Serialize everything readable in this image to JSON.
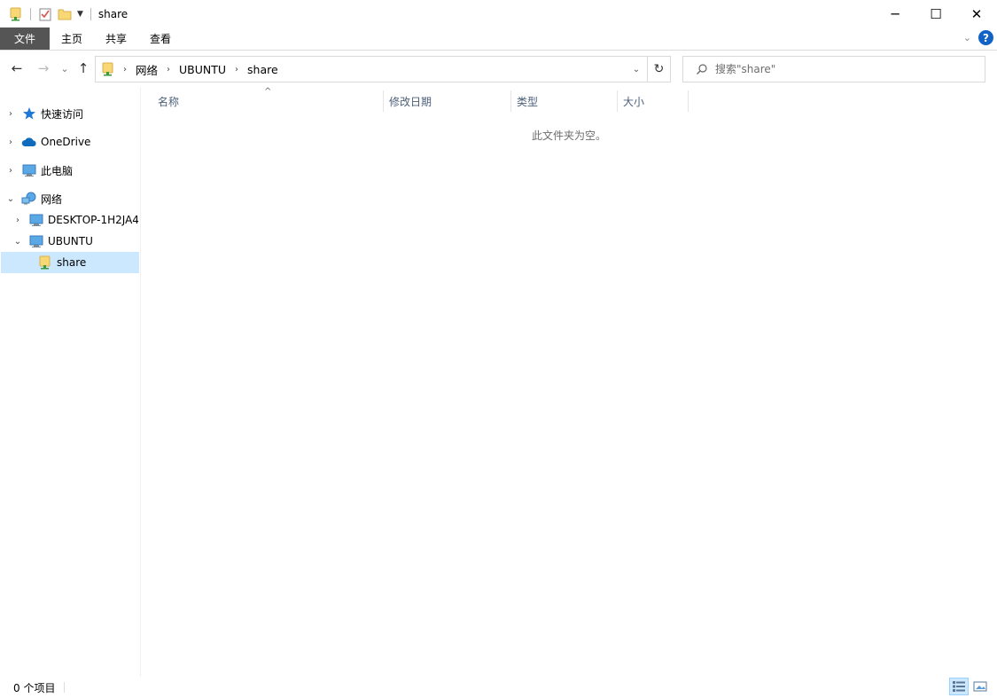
{
  "window": {
    "title": "share",
    "minimize": "─",
    "maximize": "☐",
    "close": "✕"
  },
  "quick_access_toolbar": {
    "icons": [
      "share-folder-icon",
      "properties-icon",
      "new-folder-icon",
      "customize-dropdown-icon"
    ]
  },
  "ribbon": {
    "tabs": [
      {
        "label": "文件"
      },
      {
        "label": "主页"
      },
      {
        "label": "共享"
      },
      {
        "label": "查看"
      }
    ],
    "help_label": "?"
  },
  "navigation": {
    "back": "←",
    "forward": "→",
    "recent": "⌄",
    "up": "↑"
  },
  "address_bar": {
    "crumbs": [
      {
        "label": "网络"
      },
      {
        "label": "UBUNTU"
      },
      {
        "label": "share"
      }
    ],
    "refresh": "↻"
  },
  "search": {
    "placeholder": "搜索\"share\""
  },
  "sidebar": {
    "items": [
      {
        "label": "快速访问",
        "icon": "star-icon",
        "expanded": false
      },
      {
        "label": "OneDrive",
        "icon": "cloud-icon",
        "expanded": false
      },
      {
        "label": "此电脑",
        "icon": "computer-icon",
        "expanded": false
      },
      {
        "label": "网络",
        "icon": "network-icon",
        "expanded": true
      },
      {
        "label": "DESKTOP-1H2JA4",
        "icon": "computer-icon",
        "expanded": false
      },
      {
        "label": "UBUNTU",
        "icon": "computer-icon",
        "expanded": true
      },
      {
        "label": "share",
        "icon": "share-folder-icon",
        "selected": true
      }
    ]
  },
  "columns": {
    "headers": [
      {
        "label": "名称"
      },
      {
        "label": "修改日期"
      },
      {
        "label": "类型"
      },
      {
        "label": "大小"
      }
    ],
    "sort_indicator": "^"
  },
  "content": {
    "empty_message": "此文件夹为空。"
  },
  "status_bar": {
    "item_count": "0 个项目"
  },
  "colors": {
    "accent": "#1163c5",
    "selection": "#cce8ff",
    "file_tab": "#555555",
    "header_text": "#4c607a"
  }
}
